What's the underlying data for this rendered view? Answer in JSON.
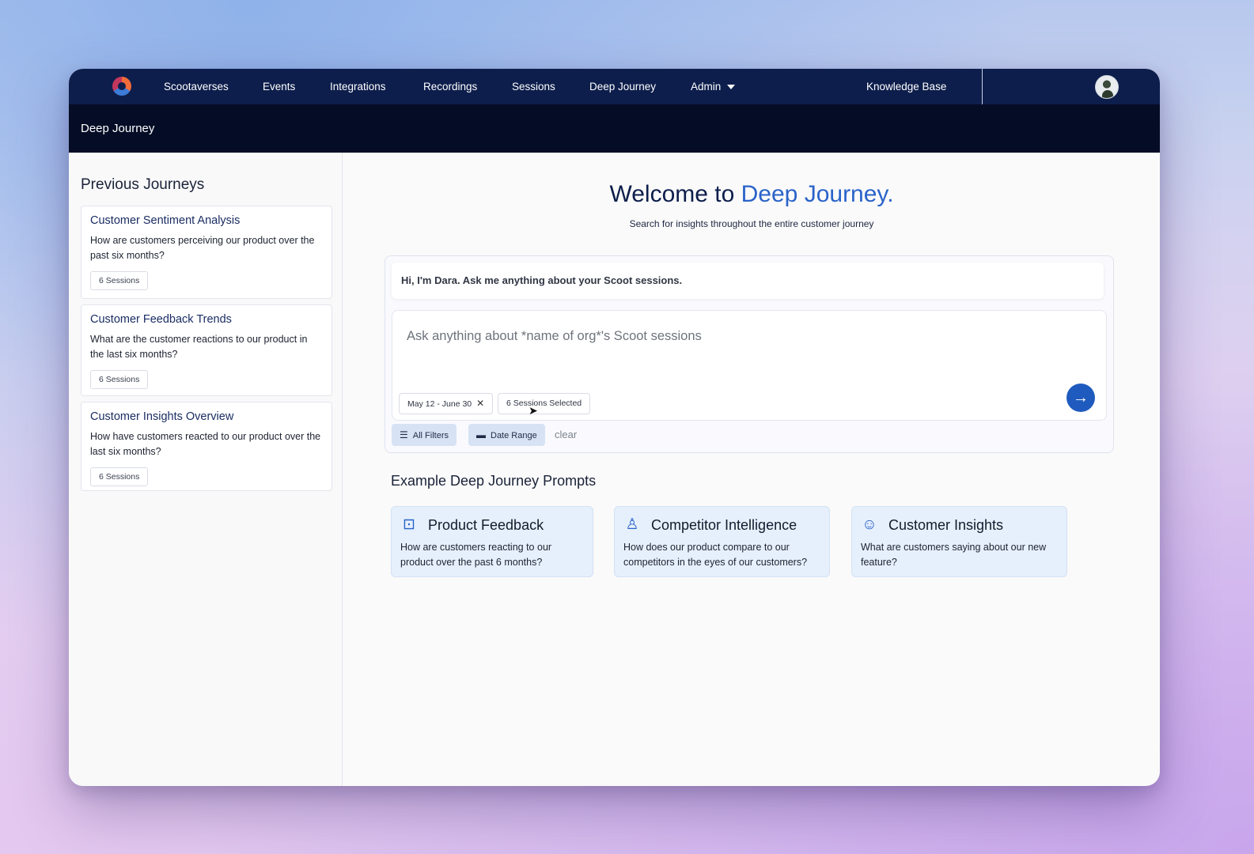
{
  "nav": {
    "items": [
      {
        "label": "Scootaverses"
      },
      {
        "label": "Events"
      },
      {
        "label": "Integrations"
      },
      {
        "label": "Recordings"
      },
      {
        "label": "Sessions"
      },
      {
        "label": "Deep Journey"
      },
      {
        "label": "Admin"
      }
    ],
    "knowledge_base": "Knowledge Base"
  },
  "subheader": {
    "title": "Deep Journey"
  },
  "sidebar": {
    "title": "Previous Journeys",
    "journeys": [
      {
        "title": "Customer Sentiment Analysis",
        "question": "How are customers perceiving our product over the past six months?",
        "badge": "6 Sessions"
      },
      {
        "title": "Customer Feedback Trends",
        "question": "What are the customer reactions to our product in the last six months?",
        "badge": "6 Sessions"
      },
      {
        "title": "Customer Insights Overview",
        "question": "How have customers reacted to our product over the last six months?",
        "badge": "6 Sessions"
      }
    ]
  },
  "main": {
    "welcome_prefix": "Welcome to ",
    "welcome_accent": "Deep Journey.",
    "subtitle": "Search for insights throughout the entire customer journey",
    "greeting": "Hi, I'm Dara. Ask me anything about your Scoot sessions.",
    "input_placeholder": "Ask anything about *name of org*'s Scoot sessions",
    "chips": {
      "date": "May 12 - June 30",
      "sessions": "6 Sessions Selected"
    },
    "filters": {
      "all": "All Filters",
      "date_range": "Date Range",
      "clear": "clear"
    },
    "examples_title": "Example Deep Journey Prompts",
    "examples": [
      {
        "title": "Product Feedback",
        "text": "How are customers reacting to our product over the past 6 months?",
        "icon": "bookmark-icon"
      },
      {
        "title": "Competitor Intelligence",
        "text": "How does our product compare to our competitors in the eyes of our customers?",
        "icon": "chess-pawn-icon"
      },
      {
        "title": "Customer Insights",
        "text": "What are customers saying about our new feature?",
        "icon": "user-circle-icon"
      }
    ]
  },
  "colors": {
    "nav_bg": "#0d1e4c",
    "subheader_bg": "#050d26",
    "accent": "#2a63c9",
    "card_bg": "#e6f0fc"
  }
}
